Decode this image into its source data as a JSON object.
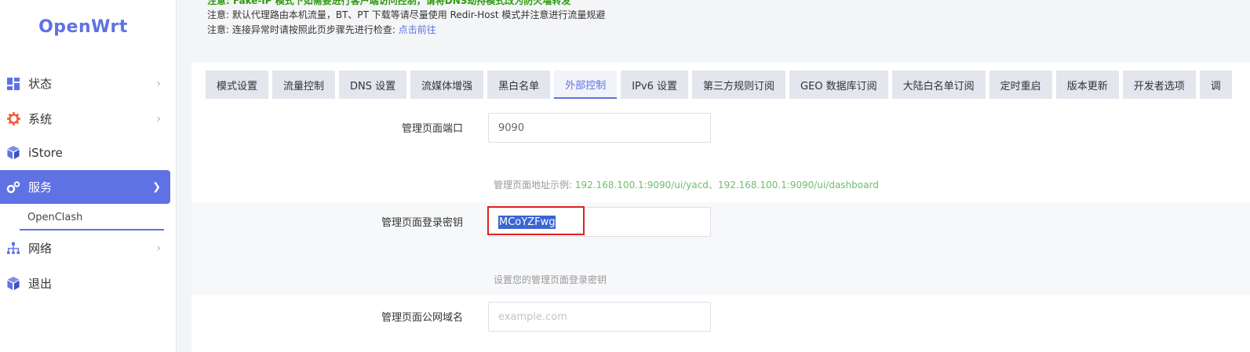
{
  "sidebar": {
    "logo": "OpenWrt",
    "items": [
      {
        "label": "状态"
      },
      {
        "label": "系统"
      },
      {
        "label": "iStore"
      },
      {
        "label": "服务"
      },
      {
        "label": "网络"
      },
      {
        "label": "退出"
      }
    ],
    "sub_item": "OpenClash",
    "accent_color": "#5e72e4"
  },
  "notices": {
    "line0": "注意: Fake-IP 模式下如需要进行客户端访问控制，请将DNS劫持模式改为防火墙转发",
    "line1": "注意: 默认代理路由本机流量，BT、PT 下载等请尽量使用 Redir-Host 模式并注意进行流量规避",
    "line2_prefix": "注意: 连接异常时请按照此页步骤先进行检查: ",
    "line2_link": "点击前往"
  },
  "tabs": [
    "模式设置",
    "流量控制",
    "DNS 设置",
    "流媒体增强",
    "黑白名单",
    "外部控制",
    "IPv6 设置",
    "第三方规则订阅",
    "GEO 数据库订阅",
    "大陆白名单订阅",
    "定时重启",
    "版本更新",
    "开发者选项",
    "调"
  ],
  "active_tab": "外部控制",
  "form": {
    "port": {
      "label": "管理页面端口",
      "value": "9090",
      "hint_prefix": "管理页面地址示例: ",
      "hint_example": "192.168.100.1:9090/ui/yacd、192.168.100.1:9090/ui/dashboard"
    },
    "secret": {
      "label": "管理页面登录密钥",
      "value": "MCoYZFwg",
      "hint": "设置您的管理页面登录密钥"
    },
    "domain": {
      "label": "管理页面公网域名",
      "placeholder": "example.com"
    }
  }
}
